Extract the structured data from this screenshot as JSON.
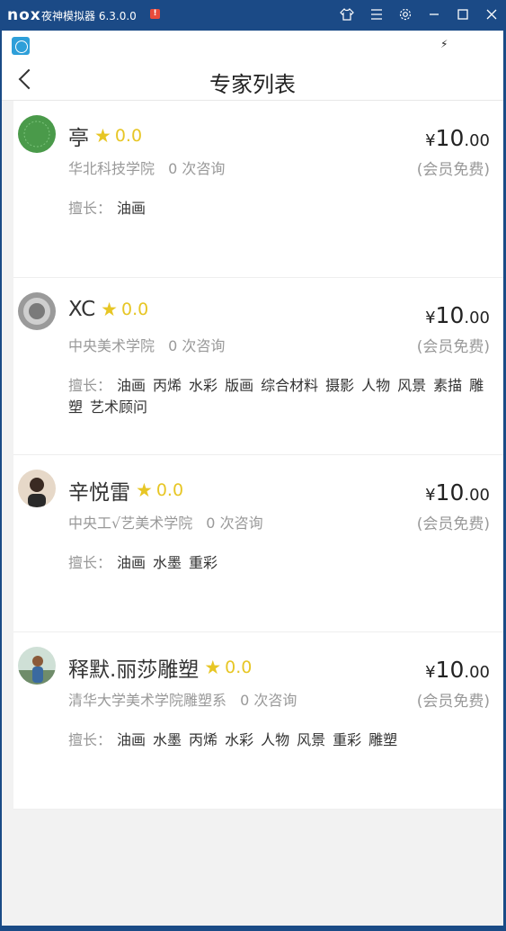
{
  "window": {
    "logo": "nox",
    "title": "夜神模拟器 6.3.0.0",
    "badge": "!"
  },
  "page": {
    "title": "专家列表"
  },
  "labels": {
    "skills": "擅长：",
    "member_free": "(会员免费)"
  },
  "experts": [
    {
      "name": "亭",
      "score": "0.0",
      "school": "华北科技学院",
      "consult": "0 次咨询",
      "price_symbol": "¥",
      "price_int": "10",
      "price_dec": ".00",
      "skills": [
        "油画"
      ],
      "avatar_color": "#4a9a4a"
    },
    {
      "name": "XC",
      "score": "0.0",
      "school": "中央美术学院",
      "consult": "0 次咨询",
      "price_symbol": "¥",
      "price_int": "10",
      "price_dec": ".00",
      "skills": [
        "油画",
        "丙烯",
        "水彩",
        "版画",
        "综合材料",
        "摄影",
        "人物",
        "风景",
        "素描",
        "雕塑",
        "艺术顾问"
      ],
      "avatar_color": "#9a9a9a"
    },
    {
      "name": "辛悦雷",
      "score": "0.0",
      "school": "中央工√艺美术学院",
      "consult": "0 次咨询",
      "price_symbol": "¥",
      "price_int": "10",
      "price_dec": ".00",
      "skills": [
        "油画",
        "水墨",
        "重彩"
      ],
      "avatar_color": "#b58a6a"
    },
    {
      "name": "释默.丽莎雕塑",
      "score": "0.0",
      "school": "清华大学美术学院雕塑系",
      "consult": "0 次咨询",
      "price_symbol": "¥",
      "price_int": "10",
      "price_dec": ".00",
      "skills": [
        "油画",
        "水墨",
        "丙烯",
        "水彩",
        "人物",
        "风景",
        "重彩",
        "雕塑"
      ],
      "avatar_color": "#6f8c6a"
    }
  ]
}
